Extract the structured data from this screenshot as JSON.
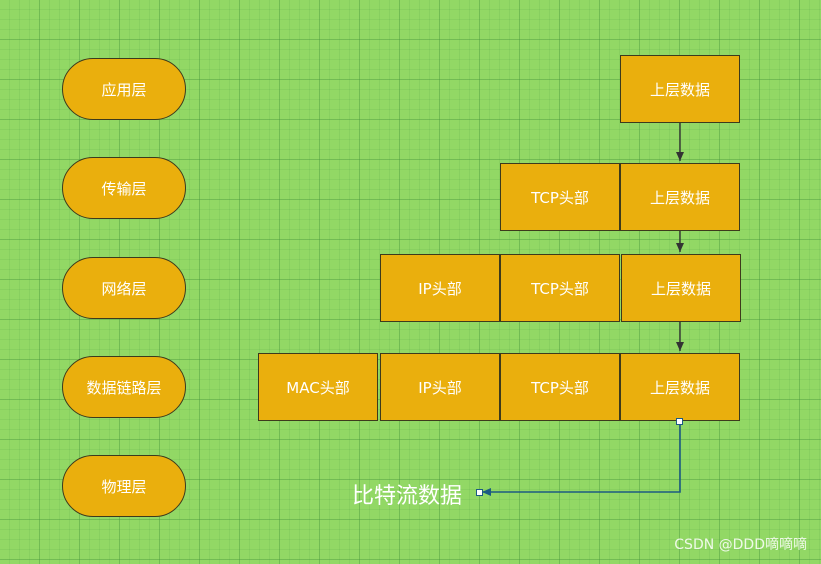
{
  "layers": [
    {
      "label": "应用层"
    },
    {
      "label": "传输层"
    },
    {
      "label": "网络层"
    },
    {
      "label": "数据链路层"
    },
    {
      "label": "物理层"
    }
  ],
  "rows": [
    {
      "cells": [
        "上层数据"
      ]
    },
    {
      "cells": [
        "TCP头部",
        "上层数据"
      ]
    },
    {
      "cells": [
        "IP头部",
        "TCP头部",
        "上层数据"
      ]
    },
    {
      "cells": [
        "MAC头部",
        "IP头部",
        "TCP头部",
        "上层数据"
      ]
    }
  ],
  "bit_stream_label": "比特流数据",
  "watermark": "CSDN @DDD嘀嘀嘀",
  "colors": {
    "background": "#92d865",
    "box_fill": "#eaaf0d",
    "box_border": "#3d3a1c",
    "text": "#ffffff",
    "selected_connector": "#1c5a82"
  }
}
